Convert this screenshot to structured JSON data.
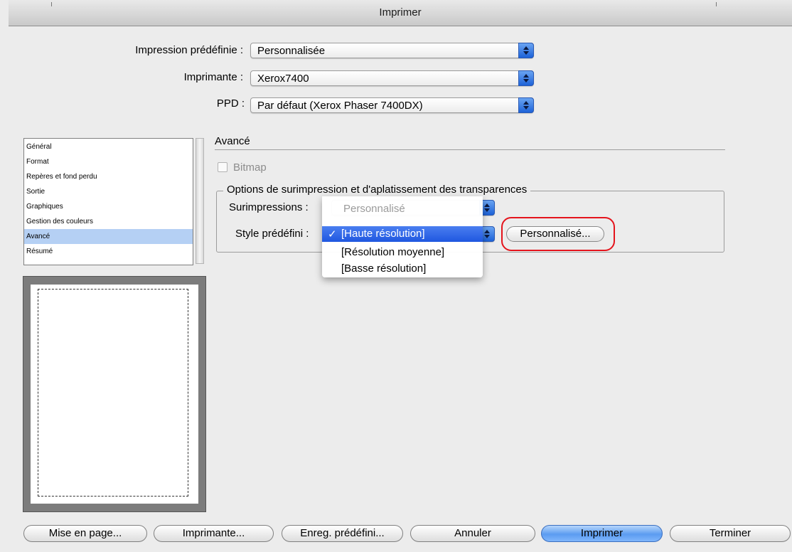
{
  "window": {
    "title": "Imprimer"
  },
  "preset": {
    "label": "Impression prédéfinie :",
    "value": "Personnalisée"
  },
  "printer": {
    "label": "Imprimante :",
    "value": "Xerox7400"
  },
  "ppd": {
    "label": "PPD :",
    "value": "Par défaut (Xerox Phaser 7400DX)"
  },
  "categories": {
    "items": [
      "Général",
      "Format",
      "Repères et fond perdu",
      "Sortie",
      "Graphiques",
      "Gestion des couleurs",
      "Avancé",
      "Résumé"
    ],
    "selected": "Avancé"
  },
  "advanced": {
    "title": "Avancé",
    "bitmap_label": "Bitmap",
    "bitmap_checked": false,
    "group_title": "Options de surimpression et d'aplatissement des transparences",
    "overprint_label": "Surimpressions :",
    "style_label": "Style prédéfini :",
    "custom_button": "Personnalisé..."
  },
  "dropdown": {
    "disabled_item": "Personnalisé",
    "checkmark": "✓",
    "items": [
      "[Haute résolution]",
      "[Résolution moyenne]",
      "[Basse résolution]"
    ],
    "selected": "[Haute résolution]"
  },
  "buttons": {
    "page_setup": "Mise en page...",
    "printer": "Imprimante...",
    "save_preset": "Enreg. prédéfini...",
    "cancel": "Annuler",
    "print": "Imprimer",
    "done": "Terminer"
  },
  "colors": {
    "highlight": "#1f57e0",
    "annotation_ring": "#e4141c",
    "list_selection": "#b5d0f4"
  }
}
